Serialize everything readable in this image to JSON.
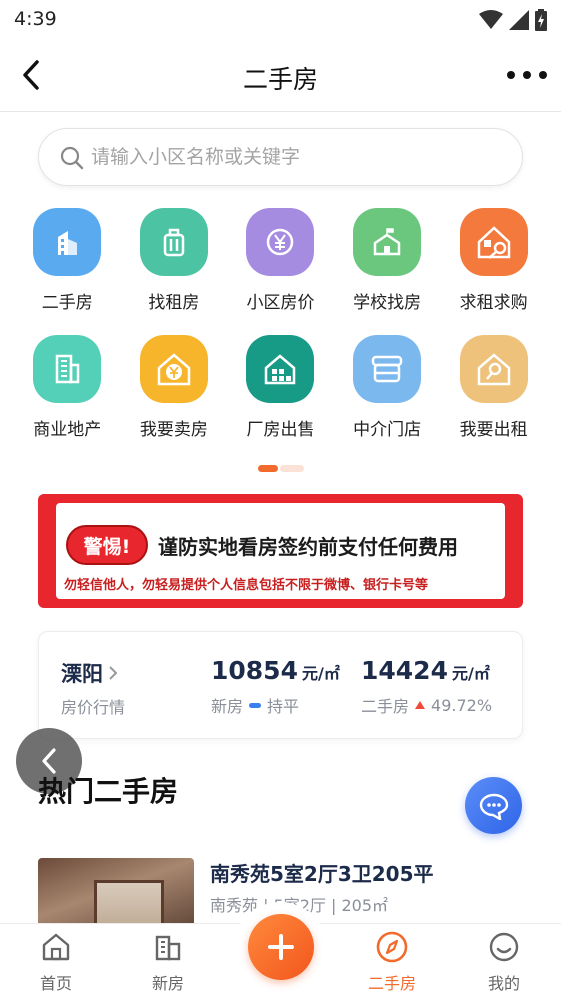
{
  "status_bar": {
    "time": "4:39"
  },
  "nav": {
    "title": "二手房"
  },
  "search": {
    "placeholder": "请输入小区名称或关键字"
  },
  "grid": {
    "row1": [
      {
        "label": "二手房",
        "icon": "building-icon",
        "color": "#5aaaf0"
      },
      {
        "label": "找租房",
        "icon": "suitcase-icon",
        "color": "#4cc4a4"
      },
      {
        "label": "小区房价",
        "icon": "yuan-coin-icon",
        "color": "#a58ce0"
      },
      {
        "label": "学校找房",
        "icon": "school-icon",
        "color": "#6cc77e"
      },
      {
        "label": "求租求购",
        "icon": "house-key-icon",
        "color": "#f3793c"
      }
    ],
    "row2": [
      {
        "label": "商业地产",
        "icon": "office-building-icon",
        "color": "#55d0b8"
      },
      {
        "label": "我要卖房",
        "icon": "house-yuan-icon",
        "color": "#f7b52c"
      },
      {
        "label": "厂房出售",
        "icon": "factory-house-icon",
        "color": "#179a86"
      },
      {
        "label": "中介门店",
        "icon": "storefront-icon",
        "color": "#7ab8ee"
      },
      {
        "label": "我要出租",
        "icon": "house-search-icon",
        "color": "#eec27a"
      }
    ]
  },
  "banner": {
    "badge": "警惕!",
    "headline": "谨防实地看房签约前支付任何费用",
    "subline": "勿轻信他人，勿轻易提供个人信息包括不限于微博、银行卡号等"
  },
  "price_card": {
    "city": "溧阳",
    "city_sub": "房价行情",
    "new_price": "10854",
    "new_unit": "元/㎡",
    "new_label": "新房",
    "new_trend": "持平",
    "used_price": "14424",
    "used_unit": "元/㎡",
    "used_label": "二手房",
    "used_trend": "49.72%"
  },
  "section": {
    "title": "热门二手房"
  },
  "listing": {
    "title": "南秀苑5室2厅3卫205平",
    "meta": "南秀苑 | 5室2厅 | 205㎡"
  },
  "tabbar": {
    "tabs": [
      {
        "label": "首页",
        "icon": "home-icon"
      },
      {
        "label": "新房",
        "icon": "buildings-icon"
      },
      {
        "label": "二手房",
        "icon": "compass-icon",
        "active": true
      },
      {
        "label": "我的",
        "icon": "smiley-icon"
      }
    ],
    "center_icon": "plus-icon"
  },
  "colors": {
    "accent": "#f26a2c",
    "navy": "#1d2b4a",
    "warning_red": "#e8262e",
    "chat_blue": "#3a72ee"
  }
}
